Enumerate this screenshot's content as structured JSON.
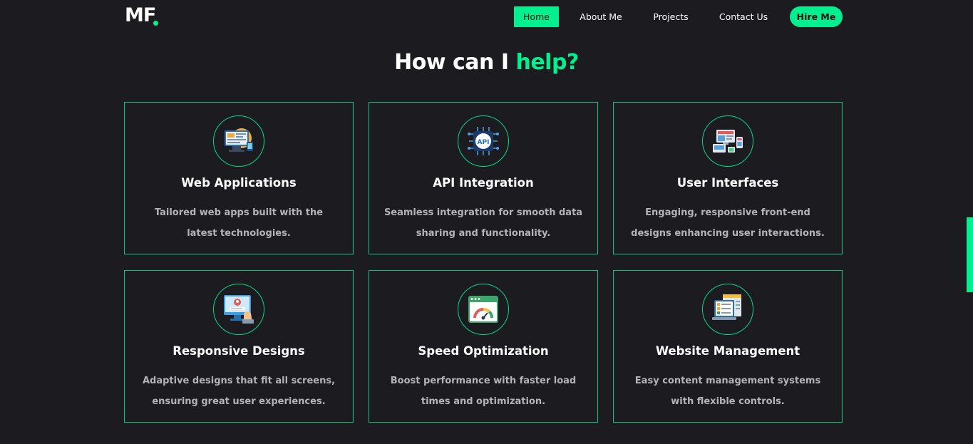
{
  "nav": {
    "logo": "MF",
    "items": [
      {
        "label": "Home"
      },
      {
        "label": "About Me"
      },
      {
        "label": "Projects"
      },
      {
        "label": "Contact Us"
      }
    ],
    "hire_label": "Hire Me"
  },
  "section": {
    "title_main": "How can I",
    "title_accent": "help?"
  },
  "services": [
    {
      "title": "Web Applications",
      "desc": "Tailored web apps built with the latest technologies.",
      "icon": "web-app-icon"
    },
    {
      "title": "API Integration",
      "desc": "Seamless integration for smooth data sharing and functionality.",
      "icon": "api-chip-icon"
    },
    {
      "title": "User Interfaces",
      "desc": "Engaging, responsive front-end designs enhancing user interactions.",
      "icon": "devices-icon"
    },
    {
      "title": "Responsive Designs",
      "desc": "Adaptive designs that fit all screens, ensuring great user experiences.",
      "icon": "monitor-user-icon"
    },
    {
      "title": "Speed Optimization",
      "desc": "Boost performance with faster load times and optimization.",
      "icon": "speedometer-icon"
    },
    {
      "title": "Website Management",
      "desc": "Easy content management systems with flexible controls.",
      "icon": "checklist-laptop-icon"
    }
  ],
  "colors": {
    "accent": "#00f08f",
    "background": "#1c1b20",
    "text_muted": "#b3b3b8"
  }
}
